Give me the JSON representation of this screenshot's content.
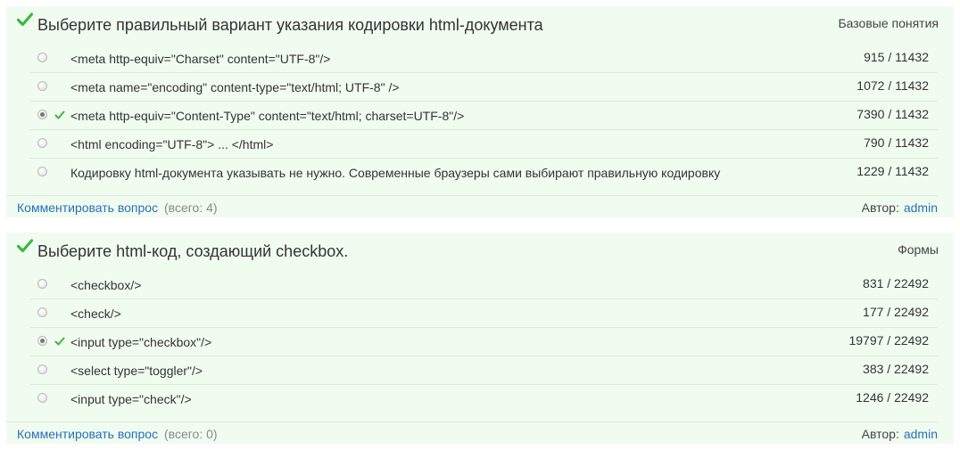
{
  "questions": [
    {
      "title": "Выберите правильный вариант указания кодировки html-документа",
      "category": "Базовые понятия",
      "answers": [
        {
          "text": "<meta http-equiv=\"Charset\" content=\"UTF-8\"/>",
          "stats": "915 / 11432",
          "selected": false,
          "correct": false
        },
        {
          "text": "<meta name=\"encoding\" content-type=\"text/html; UTF-8\" />",
          "stats": "1072 / 11432",
          "selected": false,
          "correct": false
        },
        {
          "text": "<meta http-equiv=\"Content-Type\" content=\"text/html; charset=UTF-8\"/>",
          "stats": "7390 / 11432",
          "selected": true,
          "correct": true
        },
        {
          "text": "<html encoding=\"UTF-8\"> ... </html>",
          "stats": "790 / 11432",
          "selected": false,
          "correct": false
        },
        {
          "text": "Кодировку html-документа указывать не нужно. Современные браузеры сами выбирают правильную кодировку",
          "stats": "1229 / 11432",
          "selected": false,
          "correct": false
        }
      ],
      "comment_link": "Комментировать вопрос",
      "comment_count": "(всего: 4)",
      "author_label": "Автор:",
      "author_name": "admin"
    },
    {
      "title": "Выберите html-код, создающий checkbox.",
      "category": "Формы",
      "answers": [
        {
          "text": "<checkbox/>",
          "stats": "831 / 22492",
          "selected": false,
          "correct": false
        },
        {
          "text": "<check/>",
          "stats": "177 / 22492",
          "selected": false,
          "correct": false
        },
        {
          "text": "<input type=\"checkbox\"/>",
          "stats": "19797 / 22492",
          "selected": true,
          "correct": true
        },
        {
          "text": "<select type=\"toggler\"/>",
          "stats": "383 / 22492",
          "selected": false,
          "correct": false
        },
        {
          "text": "<input type=\"check\"/>",
          "stats": "1246 / 22492",
          "selected": false,
          "correct": false
        }
      ],
      "comment_link": "Комментировать вопрос",
      "comment_count": "(всего: 0)",
      "author_label": "Автор:",
      "author_name": "admin"
    }
  ],
  "colors": {
    "card_background": "#f1fcf1",
    "check_green": "#3cb83c",
    "link_blue": "#2a6ebb"
  },
  "icons": {
    "question_status": "check-icon",
    "correct_answer": "check-icon"
  }
}
